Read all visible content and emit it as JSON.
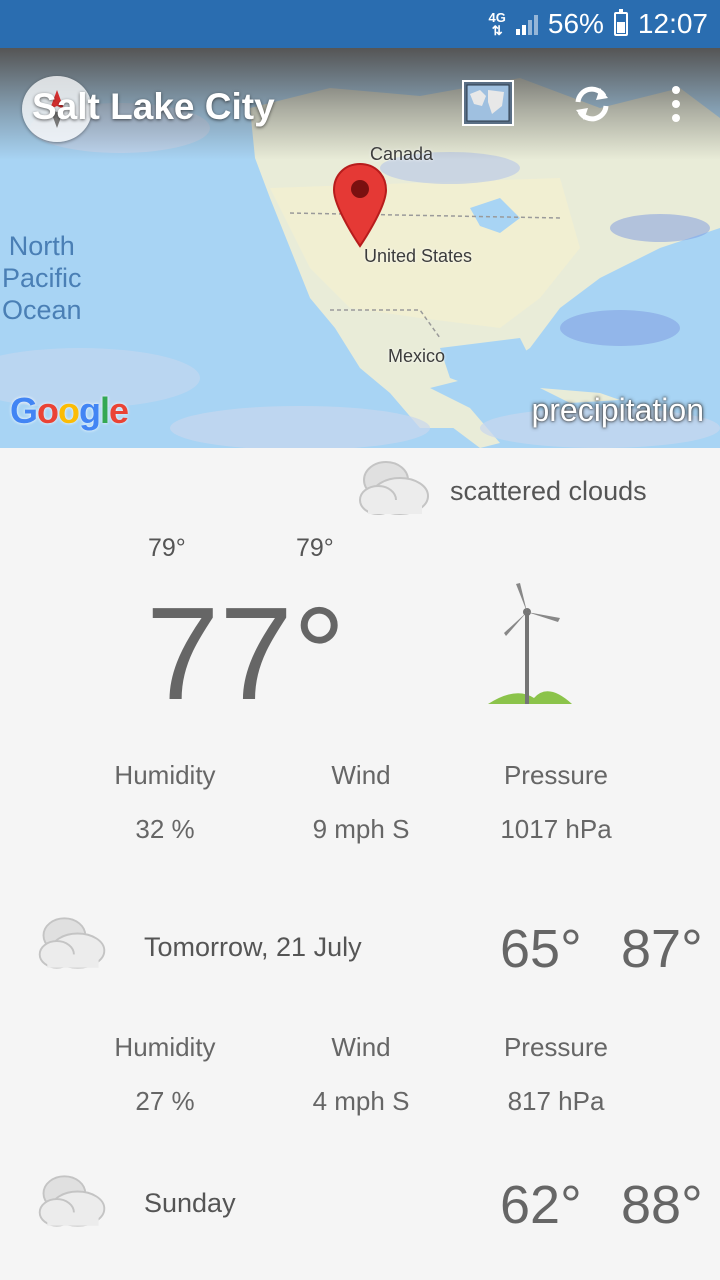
{
  "status_bar": {
    "network": "4G",
    "battery": "56%",
    "time": "12:07"
  },
  "toolbar": {
    "city": "Salt Lake City"
  },
  "map": {
    "labels": {
      "canada": "Canada",
      "united_states": "United States",
      "mexico": "Mexico",
      "ocean_line1": "North",
      "ocean_line2": "Pacific",
      "ocean_line3": "Ocean"
    },
    "attribution": "Google",
    "layer": "precipitation"
  },
  "current": {
    "condition": "scattered clouds",
    "min": "79°",
    "max": "79°",
    "temperature": "77°",
    "humidity_label": "Humidity",
    "humidity": "32 %",
    "wind_label": "Wind",
    "wind": "9 mph S",
    "pressure_label": "Pressure",
    "pressure": "1017 hPa"
  },
  "forecast": [
    {
      "day": "Tomorrow, 21 July",
      "low": "65°",
      "high": "87°",
      "humidity_label": "Humidity",
      "humidity": "27 %",
      "wind_label": "Wind",
      "wind": "4 mph S",
      "pressure_label": "Pressure",
      "pressure": "817 hPa"
    },
    {
      "day": "Sunday",
      "low": "62°",
      "high": "88°"
    }
  ],
  "colors": {
    "status_bar": "#2a6db0",
    "pin": "#e53935",
    "turbine_hill": "#8bc34a"
  }
}
